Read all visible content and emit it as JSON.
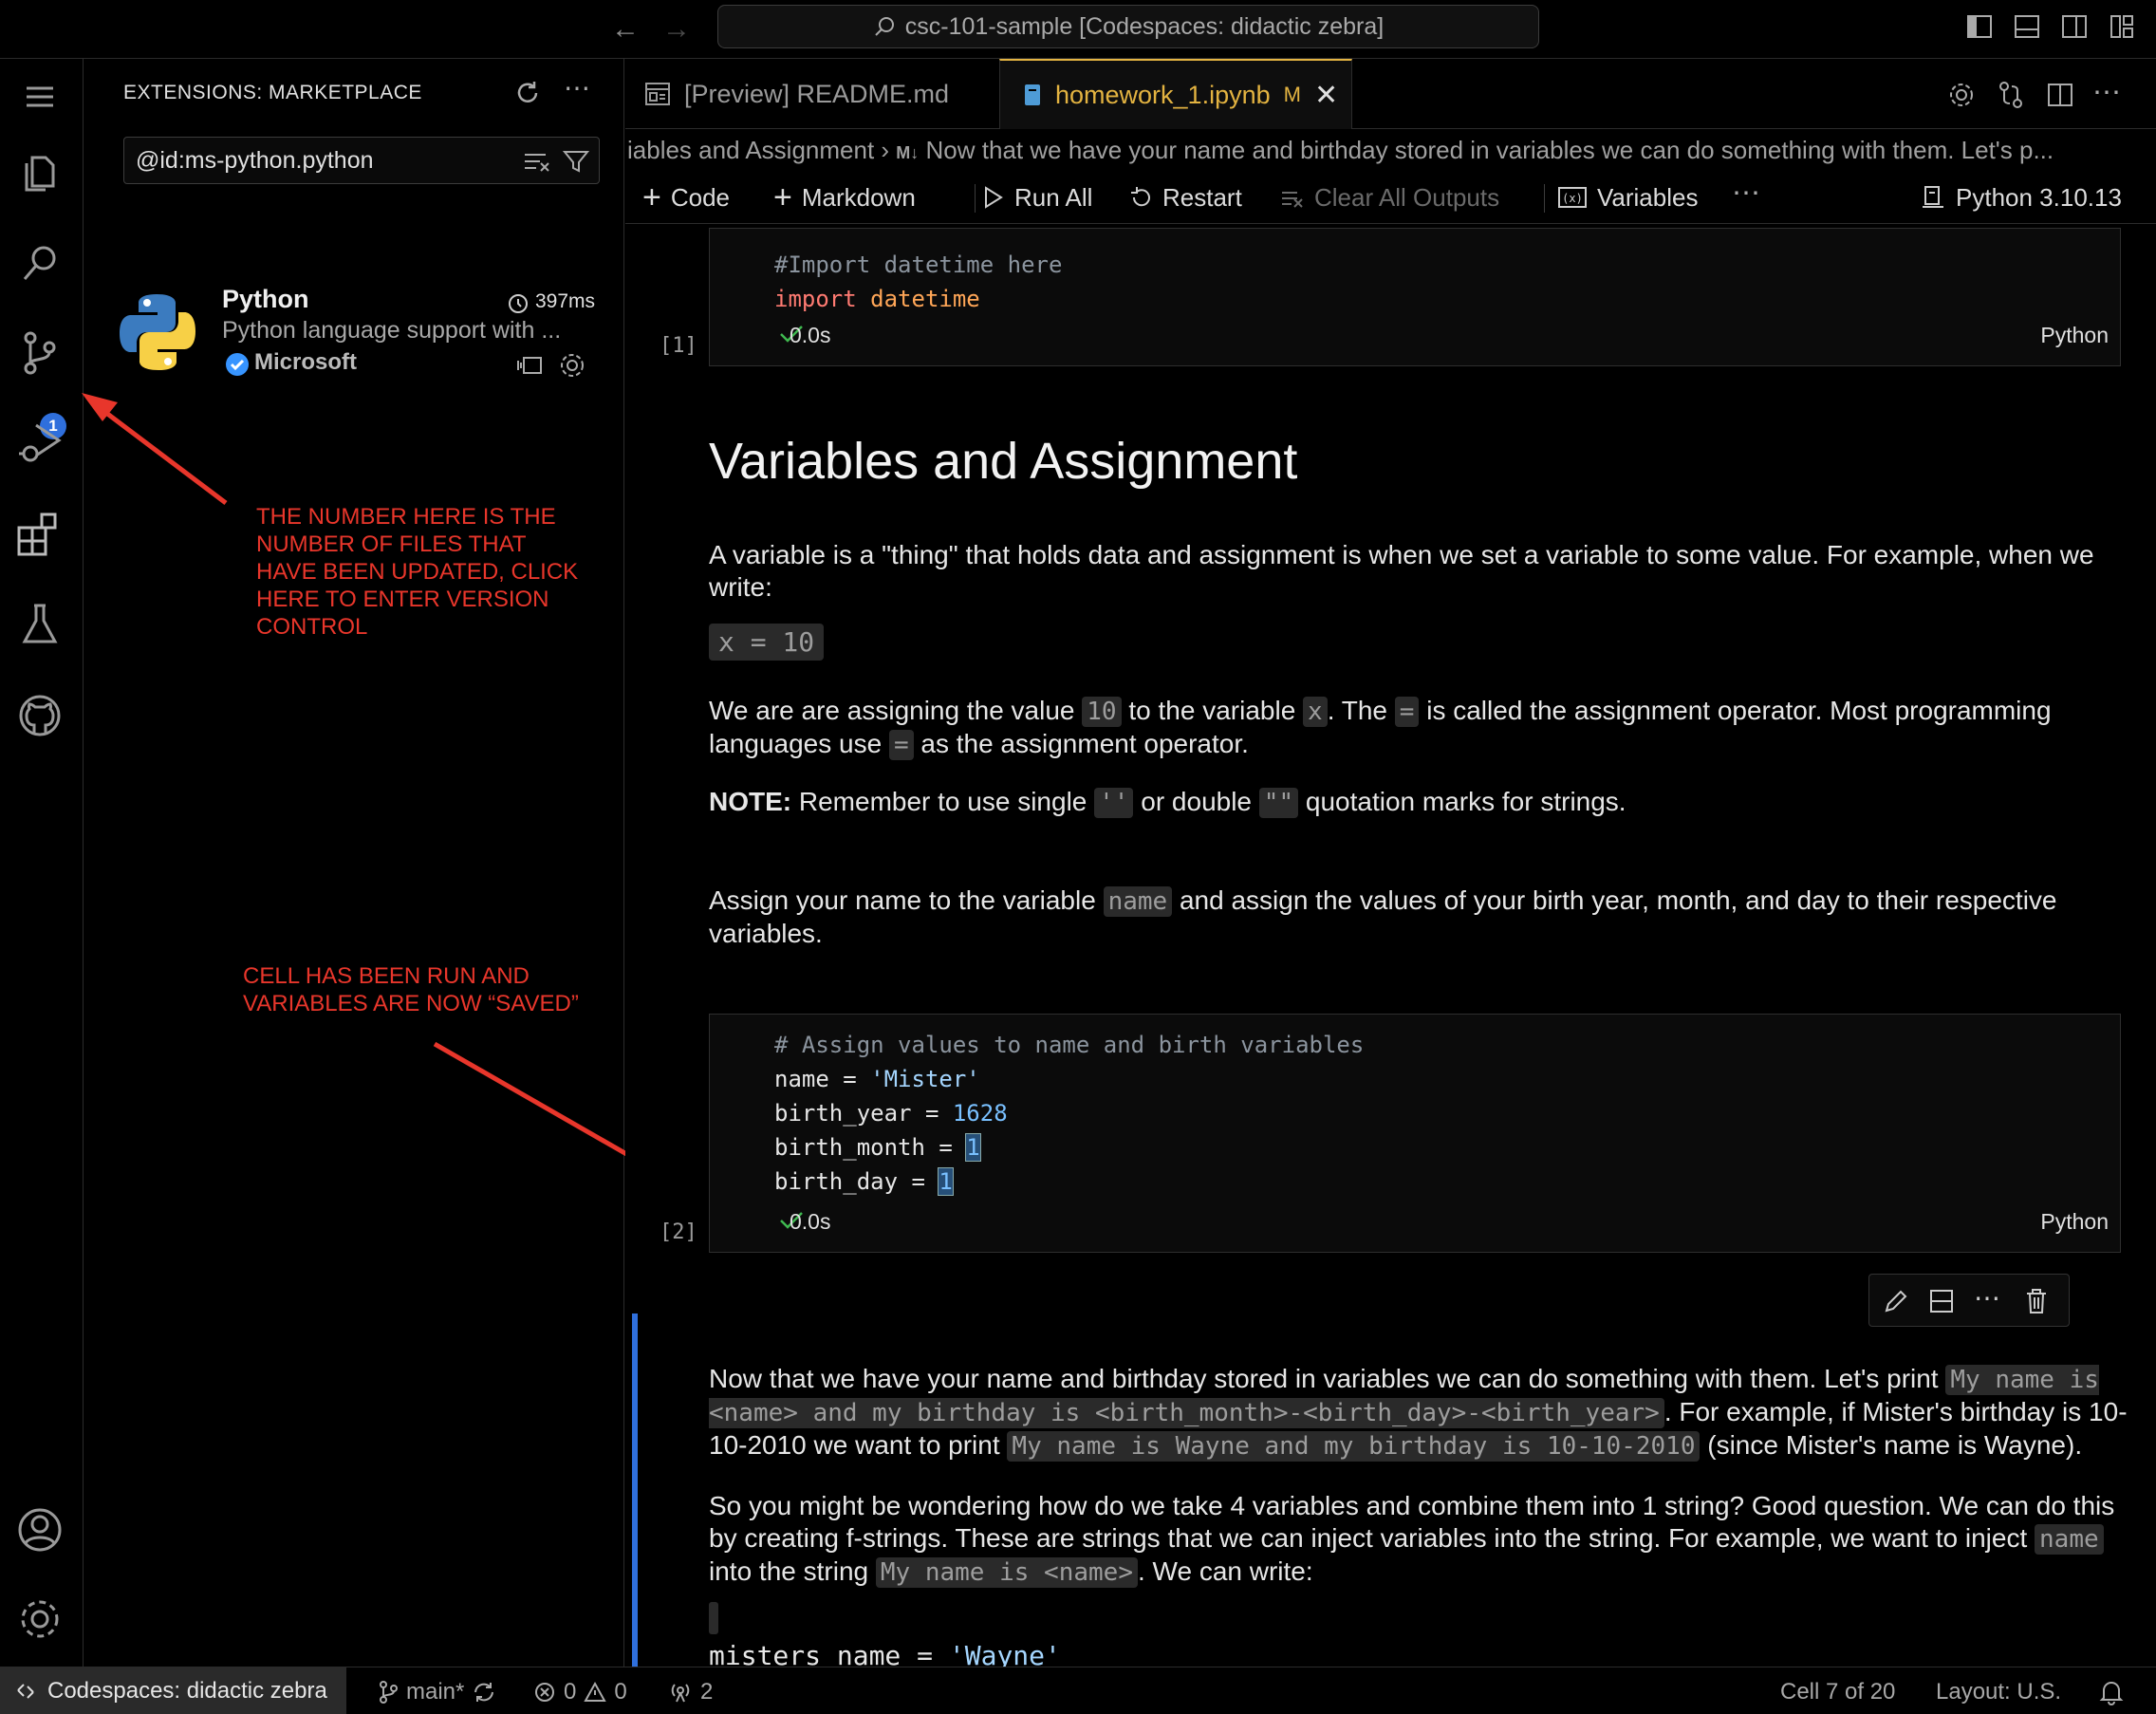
{
  "titlebar": {
    "search_text": "csc-101-sample [Codespaces: didactic zebra]"
  },
  "activitybar": {
    "scm_badge": "1"
  },
  "sidebar": {
    "title": "EXTENSIONS: MARKETPLACE",
    "search_value": "@id:ms-python.python",
    "extension": {
      "name": "Python",
      "description": "Python language support with ...",
      "publisher": "Microsoft",
      "time": "397ms"
    }
  },
  "annotations": {
    "top": "THE NUMBER HERE IS THE NUMBER OF FILES THAT HAVE BEEN UPDATED, CLICK HERE TO ENTER VERSION CONTROL",
    "bottom": "CELL HAS BEEN RUN AND VARIABLES ARE NOW “SAVED”"
  },
  "tabs": {
    "readme": "[Preview] README.md",
    "notebook": "homework_1.ipynb",
    "notebook_badge": "M"
  },
  "breadcrumb": {
    "part1": "iables and Assignment",
    "part2": "Now that we have your name and birthday stored in variables we can do something with them.  Let's p..."
  },
  "toolbar": {
    "code": "Code",
    "markdown": "Markdown",
    "run_all": "Run All",
    "restart": "Restart",
    "clear": "Clear All Outputs",
    "variables": "Variables",
    "kernel": "Python 3.10.13"
  },
  "cells": {
    "cell1": {
      "line1": "#Import datetime here",
      "kw": "import",
      "mod": "datetime",
      "index": "[1]",
      "time": "0.0s",
      "lang": "Python"
    },
    "heading": "Variables and Assignment",
    "p1": "A variable is a \"thing\" that holds data and assignment is when we set a variable to some value. For example, when we write:",
    "p1_code": "x = 10",
    "p2": {
      "a": "We are are assigning the value ",
      "c1": "10",
      "b": " to the variable ",
      "c2": "x",
      "c": ". The ",
      "c3": "=",
      "d": " is called the assignment operator. Most programming languages use ",
      "c4": "=",
      "e": " as the assignment operator."
    },
    "p3": {
      "bold": "NOTE:",
      "a": " Remember to use single ",
      "c1": "''",
      "b": " or double ",
      "c2": "\"\"",
      "c": " quotation marks for strings."
    },
    "p4": {
      "a": "Assign your name to the variable ",
      "c1": "name",
      "b": " and assign the values of your birth year, month, and day to their respective variables."
    },
    "cell2": {
      "comment": "# Assign values to name and birth variables",
      "l2a": "name = ",
      "l2b": "'Mister'",
      "l3a": "birth_year = ",
      "l3b": "1628",
      "l4a": "birth_month = ",
      "l4b": "1",
      "l5a": "birth_day = ",
      "l5b": "1",
      "index": "[2]",
      "time": "0.0s",
      "lang": "Python"
    },
    "p5": {
      "a": "Now that we have your name and birthday stored in variables we can do something with them. Let's print ",
      "c1": "My name is <name> and my birthday is <birth_month>-<birth_day>-<birth_year>",
      "b": ". For example, if Mister's birthday is 10-10-2010 we want to print ",
      "c2": "My name is Wayne and my birthday is 10-10-2010",
      "c": " (since Mister's name is Wayne)."
    },
    "p6": {
      "a": "So you might be wondering how do we take 4 variables and combine them into 1 string? Good question. We can do this by creating f-strings. These are strings that we can inject variables into the string. For example, we want to inject ",
      "c1": "name",
      "b": " into the string ",
      "c2": "My name is <name>",
      "c": ". We can write:"
    },
    "p7": {
      "a": "misters_name = ",
      "b": "'Wayne'"
    }
  },
  "statusbar": {
    "remote": "Codespaces: didactic zebra",
    "branch": "main*",
    "errors": "0",
    "warnings": "0",
    "ports": "2",
    "cell": "Cell 7 of 20",
    "layout": "Layout: U.S."
  }
}
